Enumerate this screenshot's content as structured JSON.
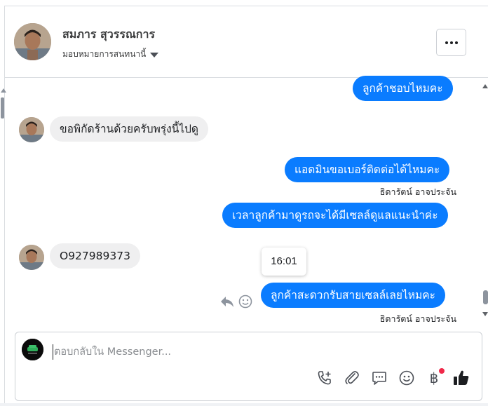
{
  "header": {
    "contact_name": "สมภาร สุวรรณการ",
    "assign_label": "มอบหมายการสนทนานี้",
    "more_icon": "more-dots-icon"
  },
  "messages": [
    {
      "type": "outgoing",
      "text": "ลูกค้าชอบไหมคะ"
    },
    {
      "type": "incoming",
      "text": "ขอพิกัดร้านด้วยครับพรุ่งนี้ไปดู"
    },
    {
      "type": "outgoing",
      "text": "แอดมินขอเบอร์ติดต่อได้ไหมคะ",
      "sender": "ธิดารัตน์ อาจประจัน"
    },
    {
      "type": "outgoing",
      "text": "เวลาลูกค้ามาดูรถจะได้มีเซลล์ดูแลแนะนำค่ะ"
    },
    {
      "type": "incoming",
      "text": "O927989373"
    },
    {
      "type": "outgoing",
      "text": "ลูกค้าสะดวกรับสายเซลล์เลยไหมคะ",
      "sender": "ธิดารัตน์ อาจประจัน"
    }
  ],
  "tooltip": {
    "time": "16:01"
  },
  "message_actions": [
    "reply-icon",
    "react-emoji-icon"
  ],
  "composer": {
    "placeholder": "ตอบกลับใน Messenger...",
    "value": "",
    "tools": [
      "add-call-icon",
      "attachment-icon",
      "saved-replies-icon",
      "emoji-icon",
      "payment-icon",
      "like-icon"
    ]
  },
  "colors": {
    "outgoing_bubble": "#0a7cff",
    "incoming_bubble": "#efeff0",
    "notification_dot": "#f02849"
  }
}
